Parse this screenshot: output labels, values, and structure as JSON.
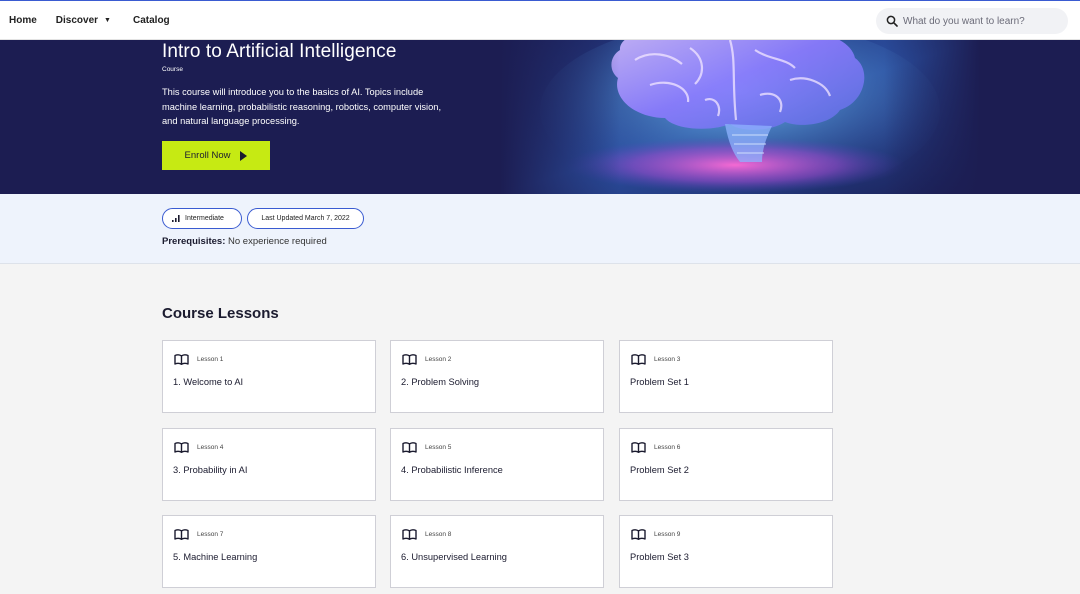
{
  "nav": {
    "home": "Home",
    "discover": "Discover",
    "catalog": "Catalog",
    "search_placeholder": "What do you want to learn?"
  },
  "hero": {
    "title": "Intro to Artificial Intelligence",
    "tag": "Course",
    "description": "This course will introduce you to the basics of AI. Topics include machine learning, probabilistic reasoning, robotics, computer vision, and natural language processing.",
    "enroll_label": "Enroll Now"
  },
  "meta": {
    "level": "Intermediate",
    "updated": "Last Updated March 7, 2022",
    "prereq_label": "Prerequisites:",
    "prereq_value": "No experience required"
  },
  "lessons": {
    "heading": "Course Lessons",
    "items": [
      {
        "number": "Lesson 1",
        "title": "1. Welcome to AI"
      },
      {
        "number": "Lesson 2",
        "title": "2. Problem Solving"
      },
      {
        "number": "Lesson 3",
        "title": "Problem Set 1"
      },
      {
        "number": "Lesson 4",
        "title": "3. Probability in AI"
      },
      {
        "number": "Lesson 5",
        "title": "4. Probabilistic Inference"
      },
      {
        "number": "Lesson 6",
        "title": "Problem Set 2"
      },
      {
        "number": "Lesson 7",
        "title": "5. Machine Learning"
      },
      {
        "number": "Lesson 8",
        "title": "6. Unsupervised Learning"
      },
      {
        "number": "Lesson 9",
        "title": "Problem Set 3"
      }
    ]
  },
  "colors": {
    "hero_bg": "#1c1d52",
    "enroll_bg": "#c6ea13",
    "accent_blue": "#3a5bd1",
    "meta_bg": "#eef3fc"
  },
  "icons": {
    "search": "search-icon",
    "caret": "chevron-down-icon",
    "play": "play-icon",
    "level": "signal-bars-icon",
    "lesson": "open-book-icon"
  }
}
